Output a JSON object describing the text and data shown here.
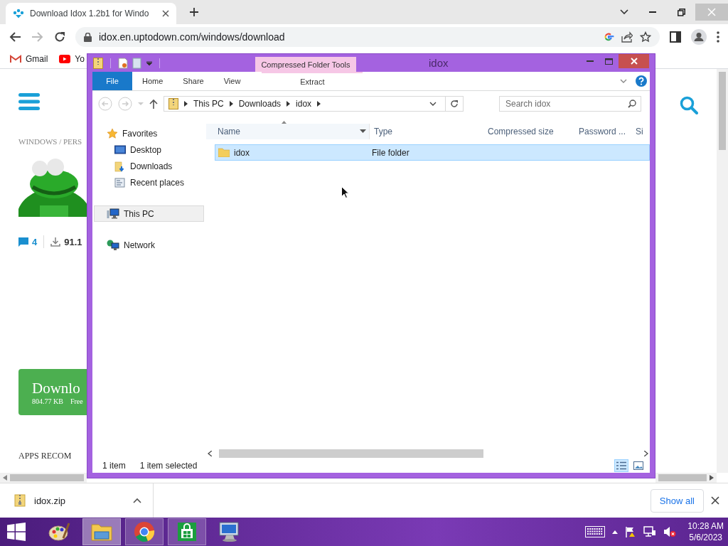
{
  "browser": {
    "tabs": [
      {
        "title": "Download Idox 1.2b1 for Windo",
        "selected": true
      }
    ],
    "address": "idox.en.uptodown.com/windows/download",
    "bookmarks": [
      {
        "label": "Gmail",
        "kind": "gmail"
      },
      {
        "label": "Yo",
        "kind": "youtube"
      }
    ]
  },
  "page": {
    "breadcrumb": "WINDOWS / PERS",
    "comments": "4",
    "downloads": "91.1",
    "download_button": {
      "label": "Downlo",
      "size": "804.77 KB",
      "license": "Free"
    },
    "section_heading": "APPS RECOM"
  },
  "explorer": {
    "title": "idox",
    "context_group": "Compressed Folder Tools",
    "ribbon_tabs": [
      {
        "label": "File",
        "kind": "file"
      },
      {
        "label": "Home",
        "kind": "tab"
      },
      {
        "label": "Share",
        "kind": "tab"
      },
      {
        "label": "View",
        "kind": "tab"
      },
      {
        "label": "Extract",
        "kind": "context"
      }
    ],
    "path": [
      "This PC",
      "Downloads",
      "idox"
    ],
    "search": {
      "placeholder": "Search idox"
    },
    "nav": [
      {
        "label": "Favorites",
        "kind": "star",
        "selected": false,
        "children": [
          {
            "label": "Desktop",
            "kind": "desktop",
            "selected": false
          },
          {
            "label": "Downloads",
            "kind": "downloads",
            "selected": false
          },
          {
            "label": "Recent places",
            "kind": "recent",
            "selected": false
          }
        ]
      },
      {
        "label": "This PC",
        "kind": "pc",
        "selected": true
      },
      {
        "label": "Network",
        "kind": "network",
        "selected": false
      }
    ],
    "columns": [
      "Name",
      "Type",
      "Compressed size",
      "Password ...",
      "Si"
    ],
    "rows": [
      {
        "name": "idox",
        "type": "File folder",
        "selected": true
      }
    ],
    "status": [
      "1 item",
      "1 item selected"
    ]
  },
  "downloads": {
    "file": "idox.zip",
    "show_all": "Show all"
  },
  "taskbar": {
    "apps": [
      {
        "kind": "paint",
        "running": false,
        "selected": false
      },
      {
        "kind": "explorer",
        "running": true,
        "selected": true
      },
      {
        "kind": "chrome",
        "running": true,
        "selected": false
      },
      {
        "kind": "store",
        "running": true,
        "selected": false
      },
      {
        "kind": "remote",
        "running": false,
        "selected": false
      }
    ],
    "time": "10:28 AM",
    "date": "5/6/2023"
  }
}
